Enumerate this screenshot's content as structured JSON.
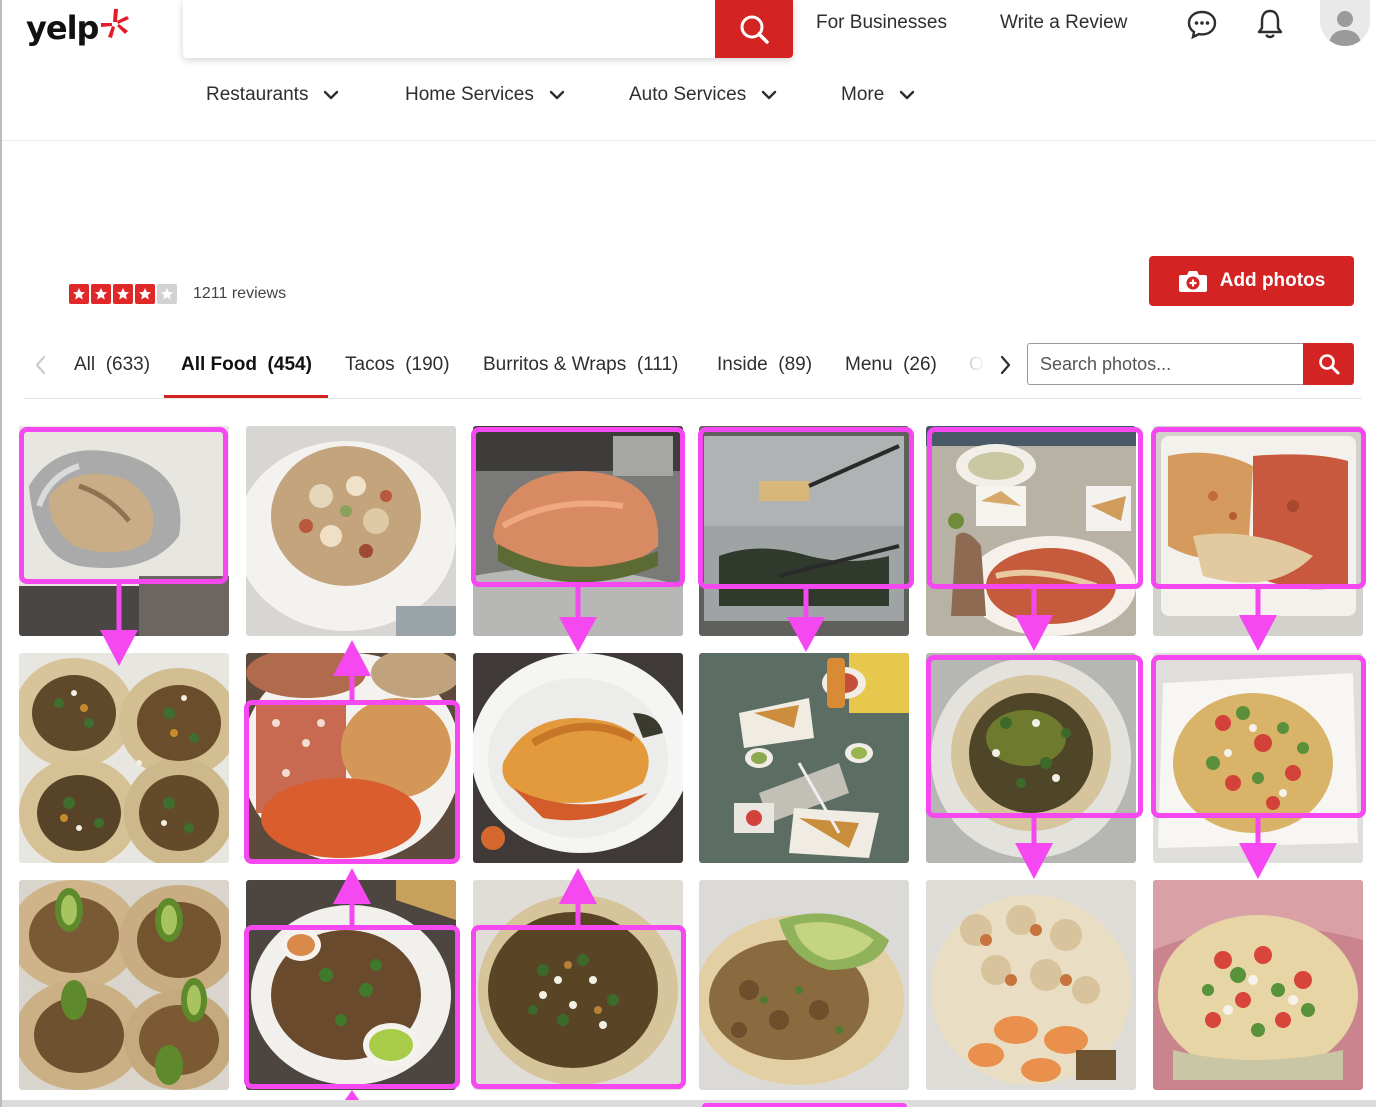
{
  "header": {
    "logo": "yelp",
    "links": [
      "For Businesses",
      "Write a Review"
    ],
    "icons": [
      "messages-icon",
      "notifications-icon",
      "user-avatar-icon"
    ]
  },
  "nav": {
    "categories": [
      "Restaurants",
      "Home Services",
      "Auto Services",
      "More"
    ]
  },
  "business": {
    "rating_stars": 4,
    "reviews": "1211 reviews"
  },
  "actions": {
    "add_photos": "Add photos"
  },
  "tabs": [
    {
      "label": "All",
      "count": "(633)"
    },
    {
      "label": "All Food",
      "count": "(454)",
      "active": true
    },
    {
      "label": "Tacos",
      "count": "(190)"
    },
    {
      "label": "Burritos & Wraps",
      "count": "(111)"
    },
    {
      "label": "Inside",
      "count": "(89)"
    },
    {
      "label": "Menu",
      "count": "(26)"
    },
    {
      "label": "O",
      "count": ""
    }
  ],
  "photo_search": {
    "placeholder": "Search photos..."
  },
  "colors": {
    "brand": "#d32323",
    "highlight": "#f548f0",
    "active_tab_underline": "#d32323"
  },
  "photos": [
    {
      "name": "foil-wrapped-burrito",
      "highlighted": true
    },
    {
      "name": "chopped-meat-plate",
      "highlighted": false
    },
    {
      "name": "torta-sandwich",
      "highlighted": true
    },
    {
      "name": "plastic-containers",
      "highlighted": true
    },
    {
      "name": "table-spread-enchiladas",
      "highlighted": true
    },
    {
      "name": "rice-and-enchilada-box",
      "highlighted": true
    },
    {
      "name": "street-tacos-pastor",
      "highlighted": false
    },
    {
      "name": "enchilada-rice-beans-plate",
      "highlighted": true
    },
    {
      "name": "chile-relleno-plate",
      "highlighted": false
    },
    {
      "name": "chips-salsa-table",
      "highlighted": false
    },
    {
      "name": "taco-with-salsa-verde",
      "highlighted": true
    },
    {
      "name": "nachos-pico-tray",
      "highlighted": true
    },
    {
      "name": "avocado-tacos",
      "highlighted": false
    },
    {
      "name": "tacos-with-guacamole-cup",
      "highlighted": true
    },
    {
      "name": "carnitas-tacos-onion",
      "highlighted": true
    },
    {
      "name": "avocado-steak-taco",
      "highlighted": false
    },
    {
      "name": "shrimp-chicken-plate",
      "highlighted": false
    },
    {
      "name": "pico-de-gallo-tostada",
      "highlighted": false
    }
  ]
}
